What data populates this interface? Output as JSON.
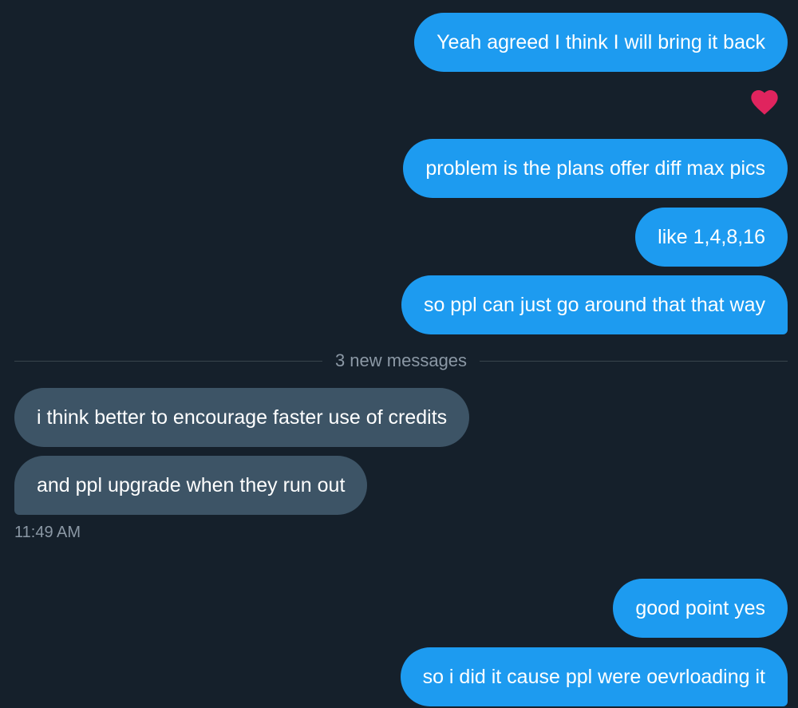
{
  "colors": {
    "background": "#15202b",
    "outgoing_bubble": "#1d9bf0",
    "incoming_bubble": "#3d5466",
    "reaction_heart": "#e0245e",
    "muted_text": "#8b98a5"
  },
  "messages": {
    "m1": "Yeah agreed I think I will bring it back",
    "m1_reaction_icon": "heart-icon",
    "m2": "problem is the plans offer diff max pics",
    "m3": "like 1,4,8,16",
    "m4": "so ppl can just go around that that way",
    "new_messages_divider": "3 new messages",
    "m5": "i think better to encourage faster use of credits",
    "m6": "and ppl upgrade when they run out",
    "m6_time": "11:49 AM",
    "m7": "good point yes",
    "m8": "so i did it cause ppl were oevrloading it"
  }
}
